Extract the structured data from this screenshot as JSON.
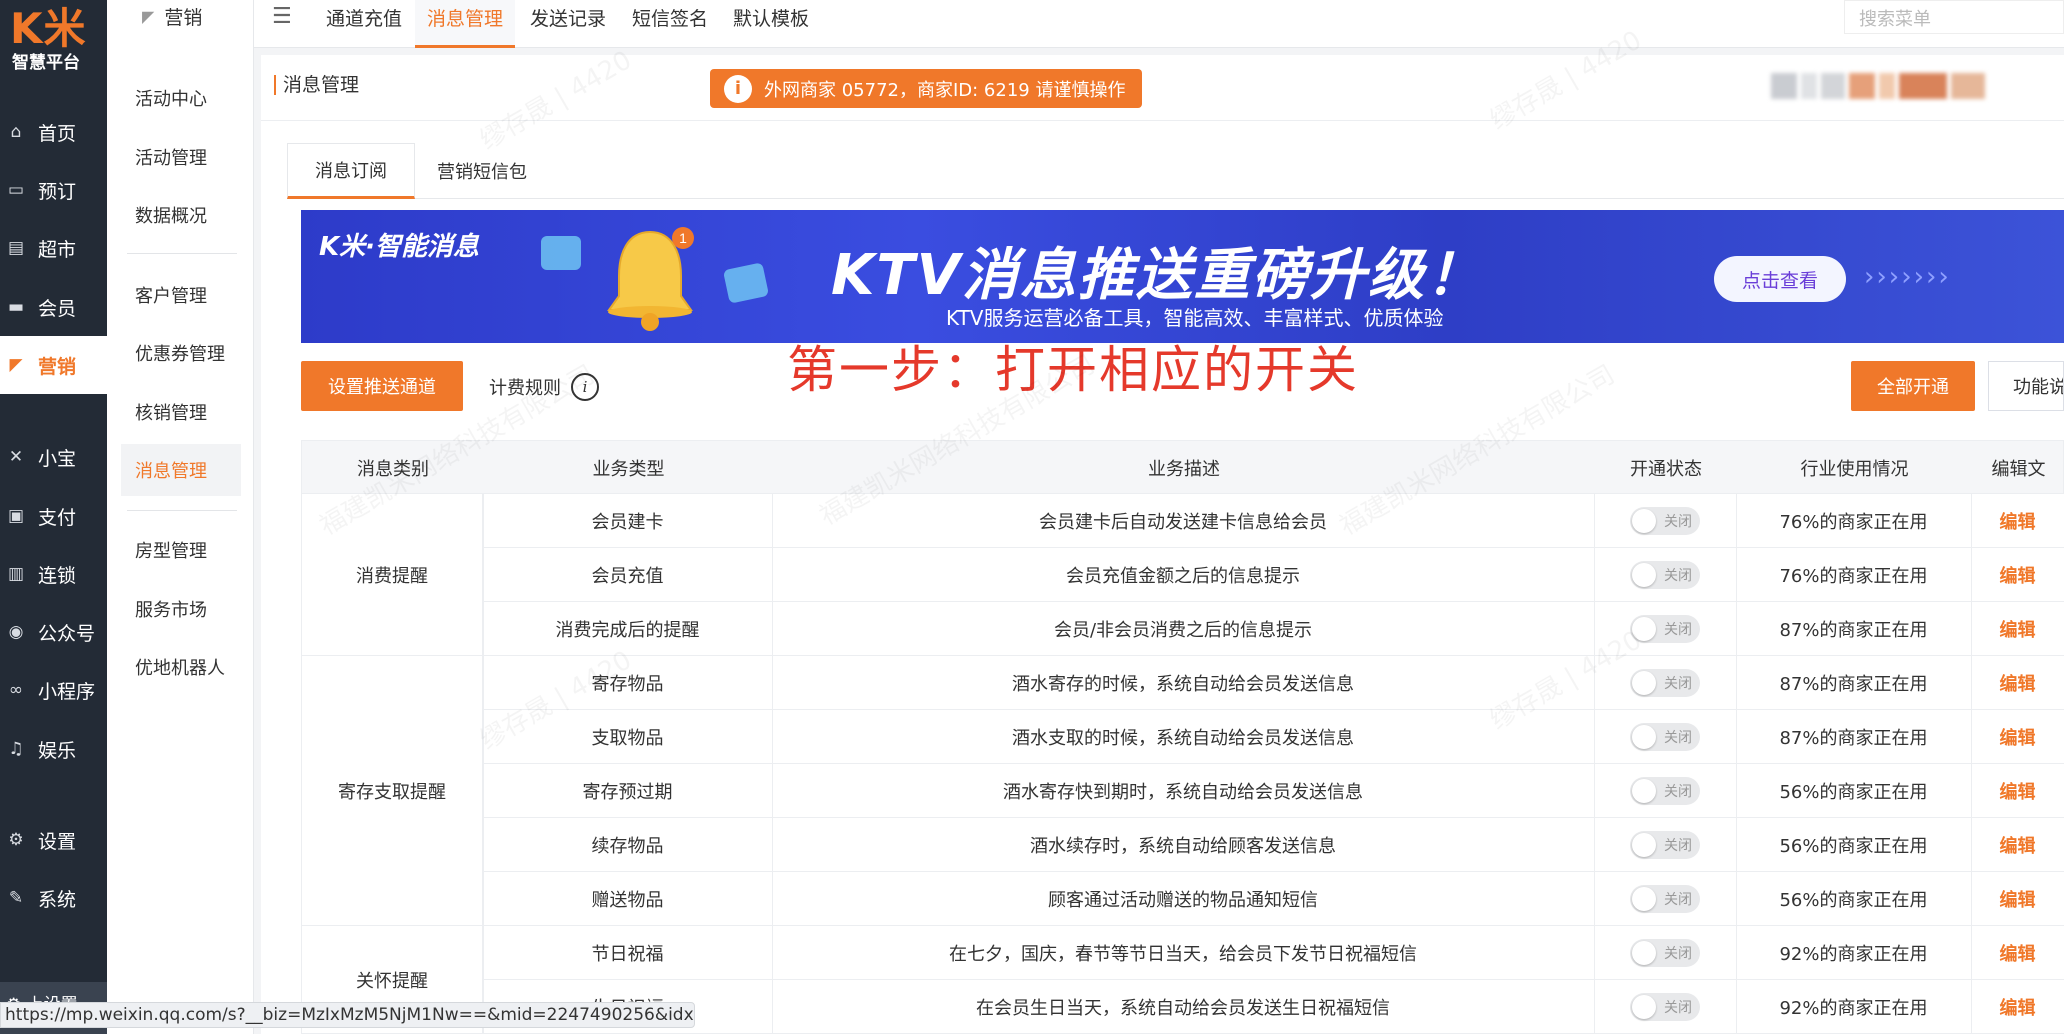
{
  "logo": {
    "mark": "K米",
    "text": "智慧平台"
  },
  "leftnav": [
    {
      "label": "首页",
      "icon": "home-icon",
      "glyph": "⌂",
      "active": false
    },
    {
      "label": "预订",
      "icon": "sofa-icon",
      "glyph": "▭",
      "active": false
    },
    {
      "label": "超市",
      "icon": "basket-icon",
      "glyph": "▤",
      "active": false
    },
    {
      "label": "会员",
      "icon": "card-icon",
      "glyph": "▬",
      "active": false
    },
    {
      "label": "营销",
      "icon": "megaphone-icon",
      "glyph": "◤",
      "active": true
    },
    {
      "label": "小宝",
      "icon": "xiaobao-icon",
      "glyph": "✕",
      "active": false
    },
    {
      "label": "支付",
      "icon": "payment-icon",
      "glyph": "▣",
      "active": false
    },
    {
      "label": "连锁",
      "icon": "store-icon",
      "glyph": "▥",
      "active": false
    },
    {
      "label": "公众号",
      "icon": "wechat-icon",
      "glyph": "◉",
      "active": false
    },
    {
      "label": "小程序",
      "icon": "miniprogram-icon",
      "glyph": "∞",
      "active": false
    },
    {
      "label": "娱乐",
      "icon": "music-icon",
      "glyph": "♫",
      "active": false
    },
    {
      "label": "设置",
      "icon": "gear-icon",
      "glyph": "⚙",
      "active": false
    },
    {
      "label": "系统",
      "icon": "wrench-icon",
      "glyph": "✎",
      "active": false
    }
  ],
  "leftnav_footer": "⚙ 上设置",
  "submenu": {
    "head": "营销",
    "items": [
      "活动中心",
      "活动管理",
      "数据概况",
      "客户管理",
      "优惠券管理",
      "核销管理",
      "消息管理",
      "房型管理",
      "服务市场",
      "优地机器人"
    ],
    "active": "消息管理"
  },
  "topbar": {
    "tabs": [
      "通道充值",
      "消息管理",
      "发送记录",
      "短信签名",
      "默认模板"
    ],
    "active_tab": "消息管理",
    "search_placeholder": "搜索菜单"
  },
  "pagehead": {
    "title": "消息管理",
    "warning": "外网商家 05772，商家ID: 6219 请谨慎操作"
  },
  "subtabs": [
    "消息订阅",
    "营销短信包"
  ],
  "banner": {
    "brand": "K米·智能消息",
    "title": "KTV消息推送重磅升级！",
    "subtitle": "KTV服务运营必备工具，智能高效、丰富样式、优质体验",
    "button": "点击查看",
    "arrows": "›››››››",
    "badge": "1"
  },
  "actions": {
    "set_channel": "设置推送通道",
    "fee_rule": "计费规则",
    "enable_all": "全部开通",
    "function_switch": "功能说"
  },
  "annotation": "第一步：打开相应的开关",
  "table": {
    "headers": [
      "消息类别",
      "业务类型",
      "业务描述",
      "开通状态",
      "行业使用情况",
      "编辑文"
    ],
    "groups": [
      {
        "label": "消费提醒"
      },
      {
        "label": "寄存支取提醒"
      },
      {
        "label": "关怀提醒"
      }
    ],
    "rows": [
      {
        "type": "会员建卡",
        "desc": "会员建卡后自动发送建卡信息给会员",
        "status": "关闭",
        "usage": "76%的商家正在用",
        "edit": "编辑"
      },
      {
        "type": "会员充值",
        "desc": "会员充值金额之后的信息提示",
        "status": "关闭",
        "usage": "76%的商家正在用",
        "edit": "编辑"
      },
      {
        "type": "消费完成后的提醒",
        "desc": "会员/非会员消费之后的信息提示",
        "status": "关闭",
        "usage": "87%的商家正在用",
        "edit": "编辑"
      },
      {
        "type": "寄存物品",
        "desc": "酒水寄存的时候，系统自动给会员发送信息",
        "status": "关闭",
        "usage": "87%的商家正在用",
        "edit": "编辑"
      },
      {
        "type": "支取物品",
        "desc": "酒水支取的时候，系统自动给会员发送信息",
        "status": "关闭",
        "usage": "87%的商家正在用",
        "edit": "编辑"
      },
      {
        "type": "寄存预过期",
        "desc": "酒水寄存快到期时，系统自动给会员发送信息",
        "status": "关闭",
        "usage": "56%的商家正在用",
        "edit": "编辑"
      },
      {
        "type": "续存物品",
        "desc": "酒水续存时，系统自动给顾客发送信息",
        "status": "关闭",
        "usage": "56%的商家正在用",
        "edit": "编辑"
      },
      {
        "type": "赠送物品",
        "desc": "顾客通过活动赠送的物品通知短信",
        "status": "关闭",
        "usage": "56%的商家正在用",
        "edit": "编辑"
      },
      {
        "type": "节日祝福",
        "desc": "在七夕，国庆，春节等节日当天，给会员下发节日祝福短信",
        "status": "关闭",
        "usage": "92%的商家正在用",
        "edit": "编辑"
      },
      {
        "type": "生日祝福",
        "desc": "在会员生日当天，系统自动给会员发送生日祝福短信",
        "status": "关闭",
        "usage": "92%的商家正在用",
        "edit": "编辑"
      }
    ]
  },
  "statusbar": "https://mp.weixin.qq.com/s?__biz=MzIxMzM5NjM1Nw==&mid=2247490256&idx...",
  "colors": {
    "accent": "#f0782a",
    "nav_bg": "#232b36",
    "annotation": "#e5392b",
    "banner": "#2d3bc9"
  }
}
